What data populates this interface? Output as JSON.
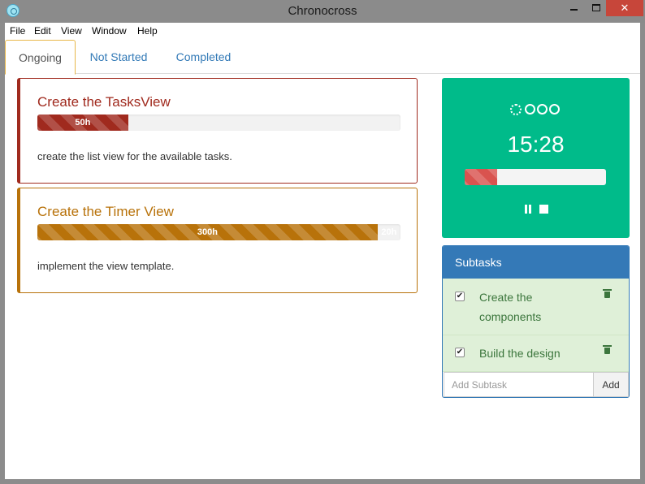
{
  "window": {
    "title": "Chronocross",
    "close_glyph": "✕"
  },
  "menu": [
    "File",
    "Edit",
    "View",
    "Window",
    "Help"
  ],
  "tabs": [
    {
      "label": "Ongoing",
      "active": true
    },
    {
      "label": "Not Started",
      "active": false
    },
    {
      "label": "Completed",
      "active": false
    }
  ],
  "tasks": [
    {
      "title": "Create the TasksView",
      "description": "create the list view for the available tasks.",
      "progress_label": "50h",
      "progress_fraction": 0.25,
      "color": "#a02a1e"
    },
    {
      "title": "Create the Timer View",
      "description": "implement the view template.",
      "progress_label": "300h",
      "remaining_label": "20h",
      "progress_fraction": 0.937,
      "color": "#b8720a"
    }
  ],
  "timer": {
    "time": "15:28",
    "progress_fraction": 0.23,
    "panel_color": "#00bb8a",
    "icons": [
      "spinner-icon",
      "circle-icon",
      "circle-icon",
      "circle-icon",
      "pause-icon",
      "stop-icon"
    ]
  },
  "subtasks": {
    "heading": "Subtasks",
    "items": [
      {
        "label": "Create the components",
        "checked": true
      },
      {
        "label": "Build the design",
        "checked": true
      }
    ],
    "add_placeholder": "Add Subtask",
    "add_button": "Add"
  }
}
